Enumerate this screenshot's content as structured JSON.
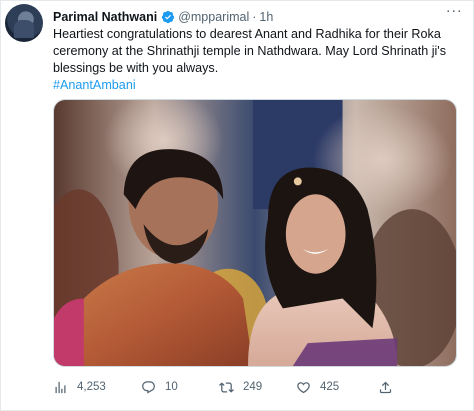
{
  "tweet": {
    "author": {
      "name": "Parimal Nathwani",
      "handle": "@mpparimal",
      "verified": true
    },
    "separator": "·",
    "time": "1h",
    "text_lines": [
      "Heartiest congratulations to dearest Anant and Radhika for their Roka",
      "ceremony at the Shrinathji temple in Nathdwara. May Lord Shrinath ji's",
      "blessings be with you always."
    ],
    "hashtag": "#AnantAmbani",
    "actions": {
      "views": "4,253",
      "replies": "10",
      "retweets": "249",
      "likes": "425"
    }
  },
  "icons": {
    "verified": "verified-badge-icon",
    "more": "more-icon",
    "views": "analytics-icon",
    "reply": "reply-icon",
    "retweet": "retweet-icon",
    "like": "heart-icon",
    "share": "share-icon"
  },
  "colors": {
    "accent": "#1d9bf0",
    "secondary_text": "#536471"
  }
}
